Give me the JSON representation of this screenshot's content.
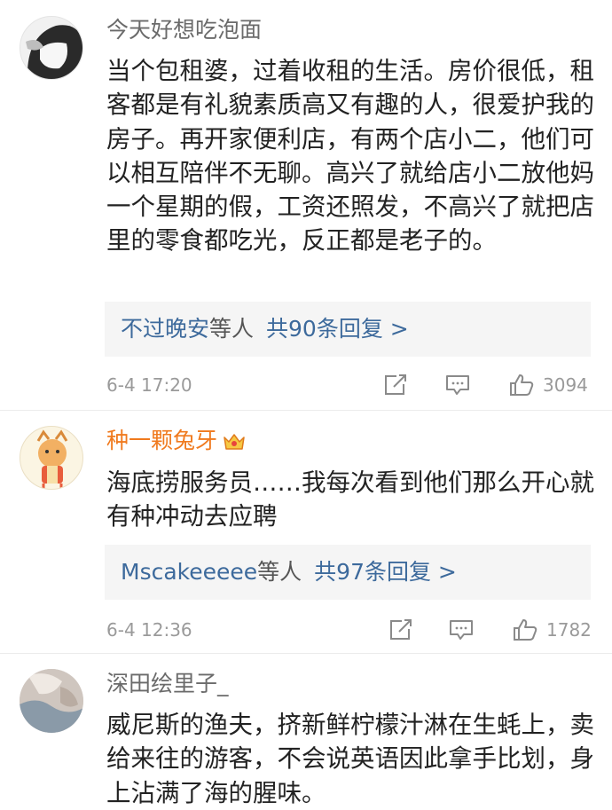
{
  "comments": [
    {
      "username": "今天好想吃泡面",
      "text": "当个包租婆，过着收租的生活。房价很低，租客都是有礼貌素质高又有趣的人，很爱护我的房子。再开家便利店，有两个店小二，他们可以相互陪伴不无聊。高兴了就给店小二放他妈一个星期的假，工资还照发，不高兴了就把店里的零食都吃光，反正都是老子的。",
      "replies": {
        "names": "不过晚安",
        "suffix": "等人",
        "count": "共90条回复 >"
      },
      "time": "6-4 17:20",
      "likes": "3094"
    },
    {
      "username": "种一颗兔牙",
      "badge": "crown-badge",
      "text": "海底捞服务员……我每次看到他们那么开心就有种冲动去应聘",
      "replies": {
        "names": "Mscakeeeee",
        "suffix": "等人",
        "count": "共97条回复 >"
      },
      "time": "6-4 12:36",
      "likes": "1782"
    },
    {
      "username": "深田绘里子_",
      "text": "威尼斯的渔夫，挤新鲜柠檬汁淋在生蚝上，卖给来往的游客，不会说英语因此拿手比划，身上沾满了海的腥味。"
    }
  ],
  "colors": {
    "link": "#3d6a9c",
    "vip_name": "#f07a1e",
    "meta": "#9a9a9a",
    "reply_bg": "#f5f5f5"
  },
  "icons": [
    "share-icon",
    "comment-icon",
    "like-icon",
    "crown-icon"
  ]
}
